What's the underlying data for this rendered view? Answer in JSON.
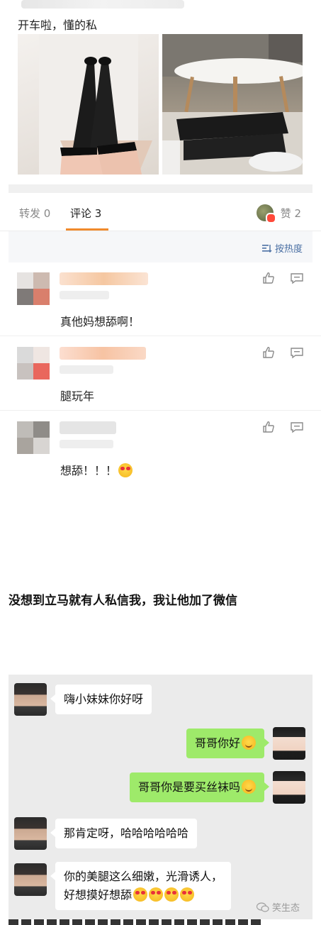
{
  "post": {
    "text": "开车啦，懂的私",
    "photos": [
      {
        "description_icon": "photo-icon"
      },
      {
        "description_icon": "photo-icon"
      }
    ]
  },
  "tabs": {
    "repost": "转发 0",
    "comment": "评论 3",
    "like": "赞 2"
  },
  "sort": {
    "label": "按热度",
    "icon": "sort-icon"
  },
  "comments": [
    {
      "text": "真他妈想舔啊！",
      "name_color": "#f7c9a6"
    },
    {
      "text": "腿玩年",
      "name_color": "#f8cdb0"
    },
    {
      "text": "想舔！！！",
      "emoji": "heart-eyes-emoji",
      "name_color": "#e2e2e2"
    }
  ],
  "caption": "没想到立马就有人私信我，我让他加了微信",
  "chat": [
    {
      "side": "left",
      "text": "嗨小妹妹你好呀"
    },
    {
      "side": "right",
      "text": "哥哥你好",
      "emoji": "smile-emoji"
    },
    {
      "side": "right",
      "text": "哥哥你是要买丝袜吗",
      "emoji": "thinking-emoji"
    },
    {
      "side": "left",
      "text": "那肯定呀，哈哈哈哈哈哈"
    },
    {
      "side": "left",
      "line1": "你的美腿这么细嫩，光滑诱人，",
      "line2": "好想摸好想舔",
      "emoji": "heart-eyes-emoji"
    }
  ],
  "watermark": {
    "text": "笑生态",
    "icon": "wechat-icon"
  },
  "colors": {
    "accent": "#f08a2c",
    "link": "#4a6fa3",
    "wechat_green": "#9eea6a",
    "chat_bg": "#ebebeb"
  }
}
